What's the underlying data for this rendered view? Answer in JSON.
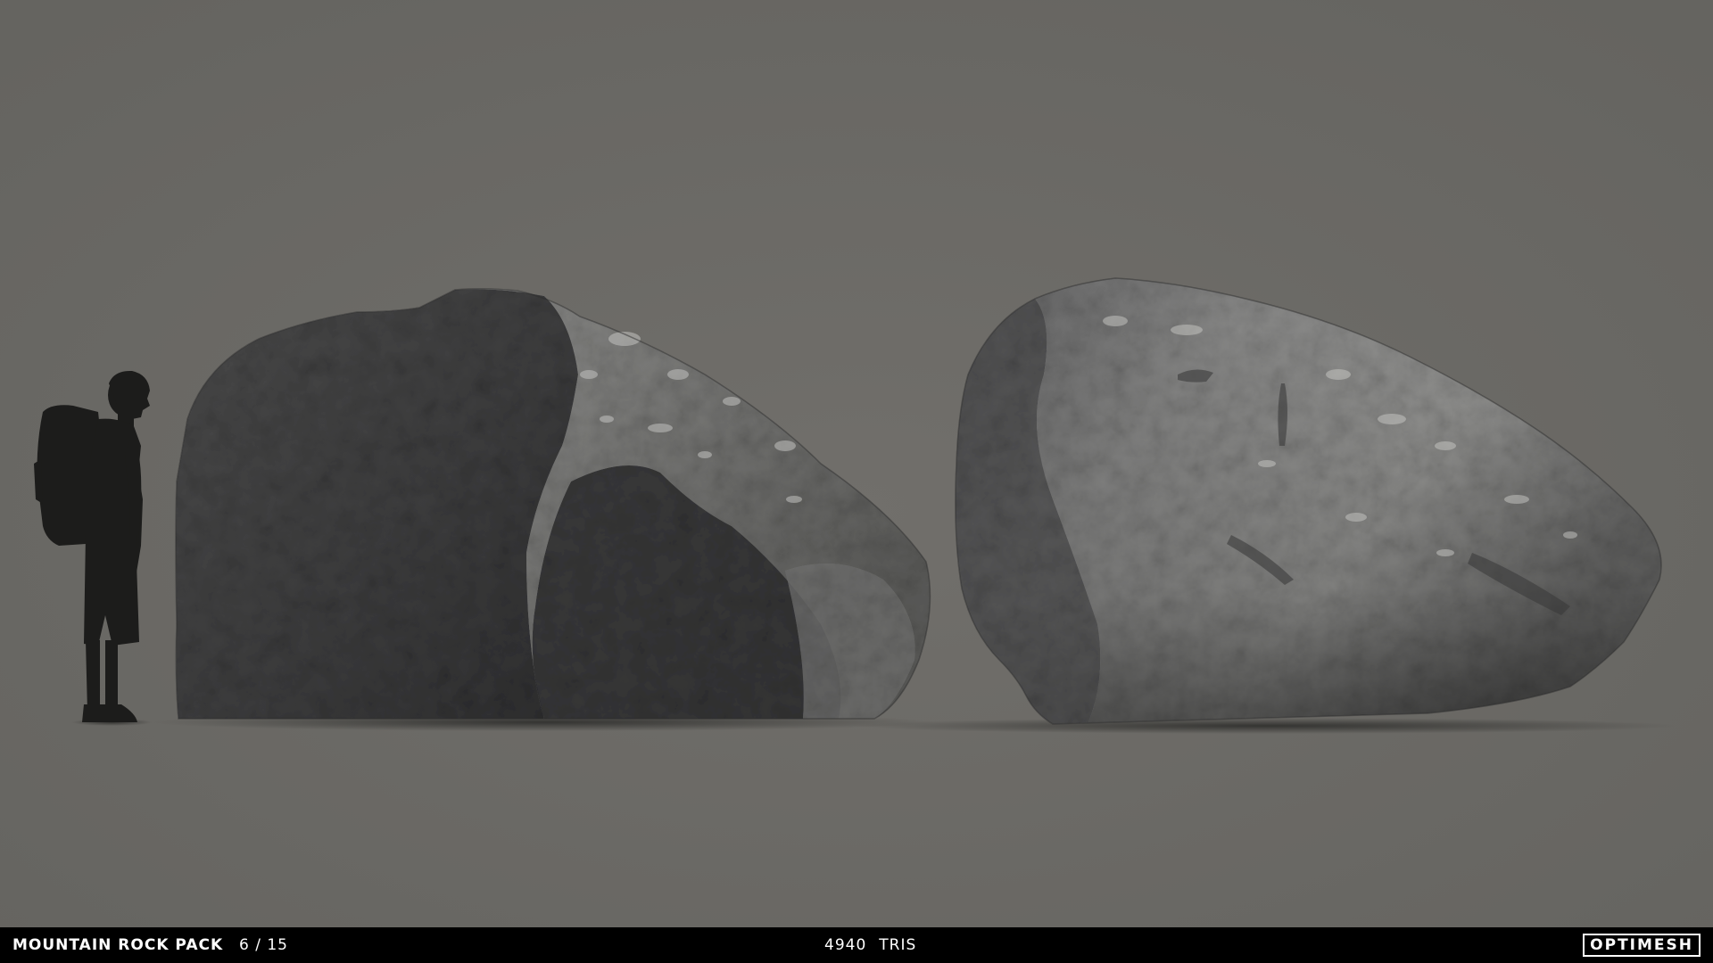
{
  "footer": {
    "pack_title": "MOUNTAIN ROCK PACK",
    "pack_count": "6 / 15",
    "tris_value": "4940",
    "tris_label": "TRIS",
    "brand": "OPTIMESH"
  },
  "scene": {
    "background_color": "#6b6a66",
    "objects": [
      "hiker-silhouette",
      "boulder-left",
      "boulder-right"
    ]
  }
}
